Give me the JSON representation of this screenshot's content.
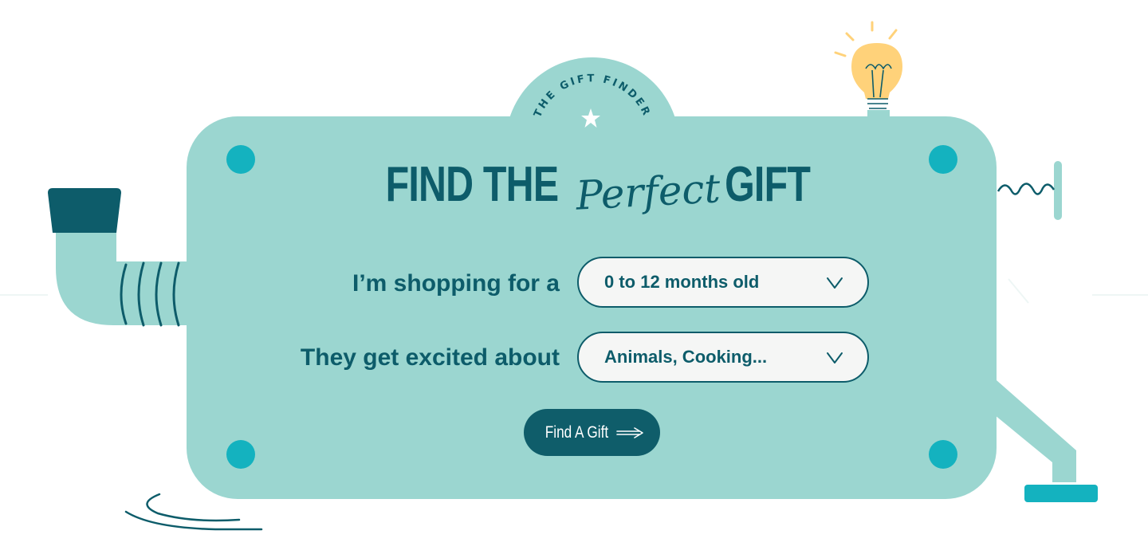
{
  "badge": {
    "text": "THE GIFT FINDER"
  },
  "headline": {
    "part1": "FIND THE",
    "script": "Perfect",
    "part2": "GIFT"
  },
  "form": {
    "row1": {
      "label": "I’m shopping for a",
      "value": "0 to 12 months old"
    },
    "row2": {
      "label": "They get excited about",
      "value": "Animals, Cooking..."
    }
  },
  "button": {
    "label": "Find A Gift"
  },
  "icons": {
    "badge_star": "star-icon",
    "dropdown": "chevron-down-icon",
    "button_arrow": "arrow-right-icon",
    "decor": "lightbulb-icon"
  },
  "colors": {
    "machine": "#9bd6d0",
    "accent": "#0d5c6a",
    "rivet": "#14b2bf",
    "bulb": "#ffd27a",
    "field_bg": "#f5f6f5",
    "button_bg": "#0f5d6a"
  }
}
